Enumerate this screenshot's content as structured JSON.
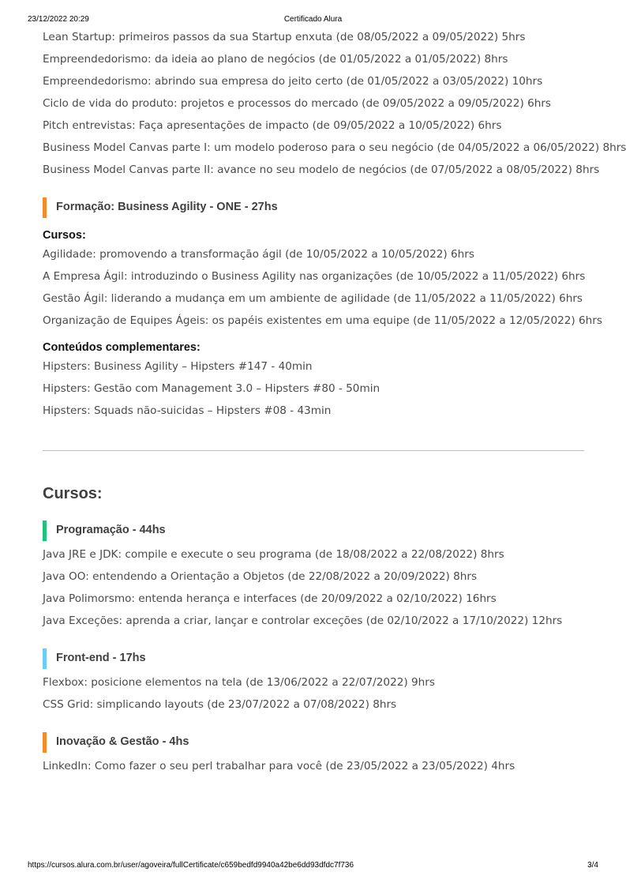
{
  "header": {
    "datetime": "23/12/2022 20:29",
    "title": "Certificado Alura"
  },
  "footer": {
    "url": "https://cursos.alura.com.br/user/agoveira/fullCertificate/c659bedfd9940a42be6dd93dfdc7f736",
    "page": "3/4"
  },
  "top_courses": [
    "Lean Startup: primeiros passos da sua Startup enxuta (de 08/05/2022 a 09/05/2022) 5hrs",
    "Empreendedorismo: da ideia ao plano de negócios (de 01/05/2022 a 01/05/2022) 8hrs",
    "Empreendedorismo: abrindo sua empresa do jeito certo (de 01/05/2022 a 03/05/2022) 10hrs",
    "Ciclo de vida do produto: projetos e processos do mercado (de 09/05/2022 a 09/05/2022) 6hrs",
    "Pitch entrevistas: Faça apresentações de impacto (de 09/05/2022 a 10/05/2022) 6hrs",
    "Business Model Canvas parte I: um modelo poderoso para o seu negócio (de 04/05/2022 a 06/05/2022) 8hrs",
    "Business Model Canvas parte II: avance no seu modelo de negócios (de 07/05/2022 a 08/05/2022) 8hrs"
  ],
  "formacao": {
    "title": "Formação: Business Agility - ONE - 27hs",
    "accent": "#f58a2b",
    "courses_heading": "Cursos:",
    "courses": [
      "Agilidade: promovendo a transformação ágil (de 10/05/2022 a 10/05/2022) 6hrs",
      "A Empresa Ágil: introduzindo o Business Agility nas organizações (de 10/05/2022 a 11/05/2022) 6hrs",
      "Gestão Ágil: liderando a mudança em um ambiente de agilidade (de 11/05/2022 a 11/05/2022) 6hrs",
      "Organização de Equipes Ágeis: os papéis existentes em uma equipe (de 11/05/2022 a 12/05/2022) 6hrs"
    ],
    "extras_heading": "Conteúdos complementares:",
    "extras": [
      "Hipsters: Business Agility – Hipsters #147 - 40min",
      "Hipsters: Gestão com Management 3.0 – Hipsters #80 - 50min",
      "Hipsters: Squads não-suicidas – Hipsters #08 - 43min"
    ]
  },
  "cursos_title": "Cursos:",
  "categories": [
    {
      "title": "Programação - 44hs",
      "accent": "#1ec27a",
      "items": [
        "Java JRE e JDK: compile e execute o seu programa (de 18/08/2022 a 22/08/2022) 8hrs",
        "Java OO: entendendo a Orientação a Objetos (de 22/08/2022 a 20/09/2022) 8hrs",
        "Java Polimorsmo: entenda herança e interfaces (de 20/09/2022 a 02/10/2022) 16hrs",
        "Java Exceções: aprenda a criar, lançar e controlar exceções (de 02/10/2022 a 17/10/2022) 12hrs"
      ]
    },
    {
      "title": "Front-end - 17hs",
      "accent": "#6bcdf5",
      "items": [
        "Flexbox: posicione elementos na tela (de 13/06/2022 a 22/07/2022) 9hrs",
        "CSS Grid: simplicando layouts (de 23/07/2022 a 07/08/2022) 8hrs"
      ]
    },
    {
      "title": "Inovação & Gestão - 4hs",
      "accent": "#f58a2b",
      "items": [
        "LinkedIn: Como fazer o seu perl trabalhar para você (de 23/05/2022 a 23/05/2022) 4hrs"
      ]
    }
  ]
}
